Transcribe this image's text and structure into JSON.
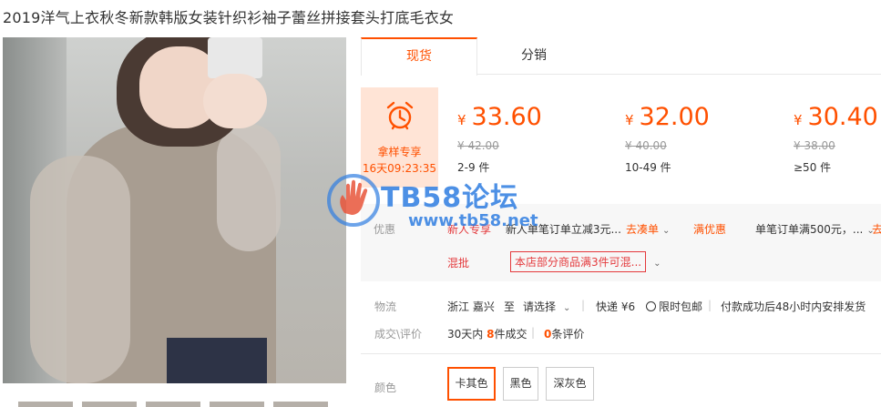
{
  "product": {
    "title": "2019洋气上衣秋冬新款韩版女装针织衫袖子蕾丝拼接套头打底毛衣女"
  },
  "tabs": [
    "现货",
    "分销"
  ],
  "sample": {
    "label": "拿样专享",
    "countdown": "16天09:23:35",
    "icon": "alarm-clock-icon"
  },
  "tiers": [
    {
      "currency": "¥",
      "price": "33.60",
      "original": "¥ 42.00",
      "qty": "2-9 件"
    },
    {
      "currency": "¥",
      "price": "32.00",
      "original": "¥ 40.00",
      "qty": "10-49 件"
    },
    {
      "currency": "¥",
      "price": "30.40",
      "original": "¥ 38.00",
      "qty": "≥50 件"
    }
  ],
  "promo": {
    "label": "优惠",
    "new_tag": "新人专享",
    "new_text": "新人单笔订单立减3元...",
    "collect": "去凑单",
    "full_tag": "满优惠",
    "full_text": "单笔订单满500元，...",
    "cut": "去",
    "mix_label": "混批",
    "mix_text": "本店部分商品满3件可混..."
  },
  "watermark": {
    "main": "TB58论坛",
    "url": "www.tb58.net"
  },
  "logistics": {
    "label": "物流",
    "from": "浙江 嘉兴",
    "to_word": "至",
    "select": "请选择",
    "express": "快递 ¥6",
    "free": "限时包邮",
    "ship": "付款成功后48小时内安排发货"
  },
  "deals": {
    "label": "成交\\评价",
    "days": "30天内",
    "count": "8",
    "count_unit": "件成交",
    "reviews": "0",
    "reviews_unit": "条评价"
  },
  "colors": {
    "label": "颜色",
    "options": [
      "卡其色",
      "黑色",
      "深灰色"
    ]
  },
  "accent": "#ff5000"
}
